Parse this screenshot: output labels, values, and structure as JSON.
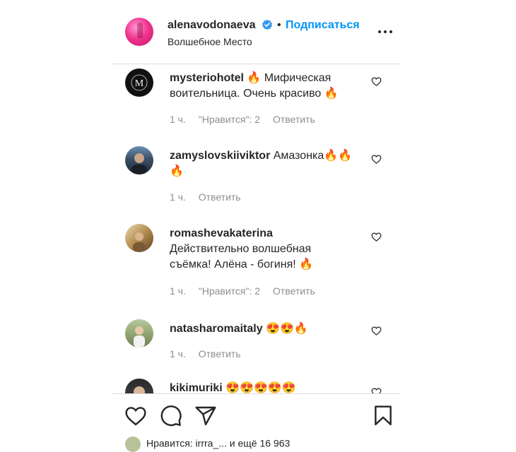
{
  "header": {
    "username": "alenavodonaeva",
    "separator": "•",
    "follow_label": "Подписаться",
    "location": "Волшебное Место"
  },
  "icons": {
    "verified": "verified-badge-icon",
    "more": "more-options-icon",
    "heart": "heart-icon",
    "comment": "comment-icon",
    "share": "share-icon",
    "save": "bookmark-icon"
  },
  "colors": {
    "link": "#0095f6",
    "text": "#262626",
    "muted": "#8e8e8e",
    "divider": "#dbdbdb"
  },
  "comments": [
    {
      "user": "mysteriohotel",
      "text_a": "🔥 Мифическая воительница. Очень красиво 🔥",
      "time": "1 ч.",
      "likes": "\"Нравится\": 2",
      "reply": "Ответить"
    },
    {
      "user": "zamyslovskiiviktor",
      "text_a": "Амазонка🔥🔥🔥",
      "time": "1 ч.",
      "likes": "",
      "reply": "Ответить"
    },
    {
      "user": "romashevakaterina",
      "text_a": "Действительно волшебная съёмка! Алёна - богиня! 🔥",
      "time": "1 ч.",
      "likes": "\"Нравится\": 2",
      "reply": "Ответить"
    },
    {
      "user": "natasharomaitaly",
      "text_a": "😍😍🔥",
      "time": "1 ч.",
      "likes": "",
      "reply": "Ответить"
    },
    {
      "user": "kikimuriki",
      "text_a": "😍😍😍😍😍",
      "time": "",
      "likes": "",
      "reply": ""
    }
  ],
  "footer": {
    "likes_text": "Нравится: irrra_... и ещё 16 963"
  }
}
